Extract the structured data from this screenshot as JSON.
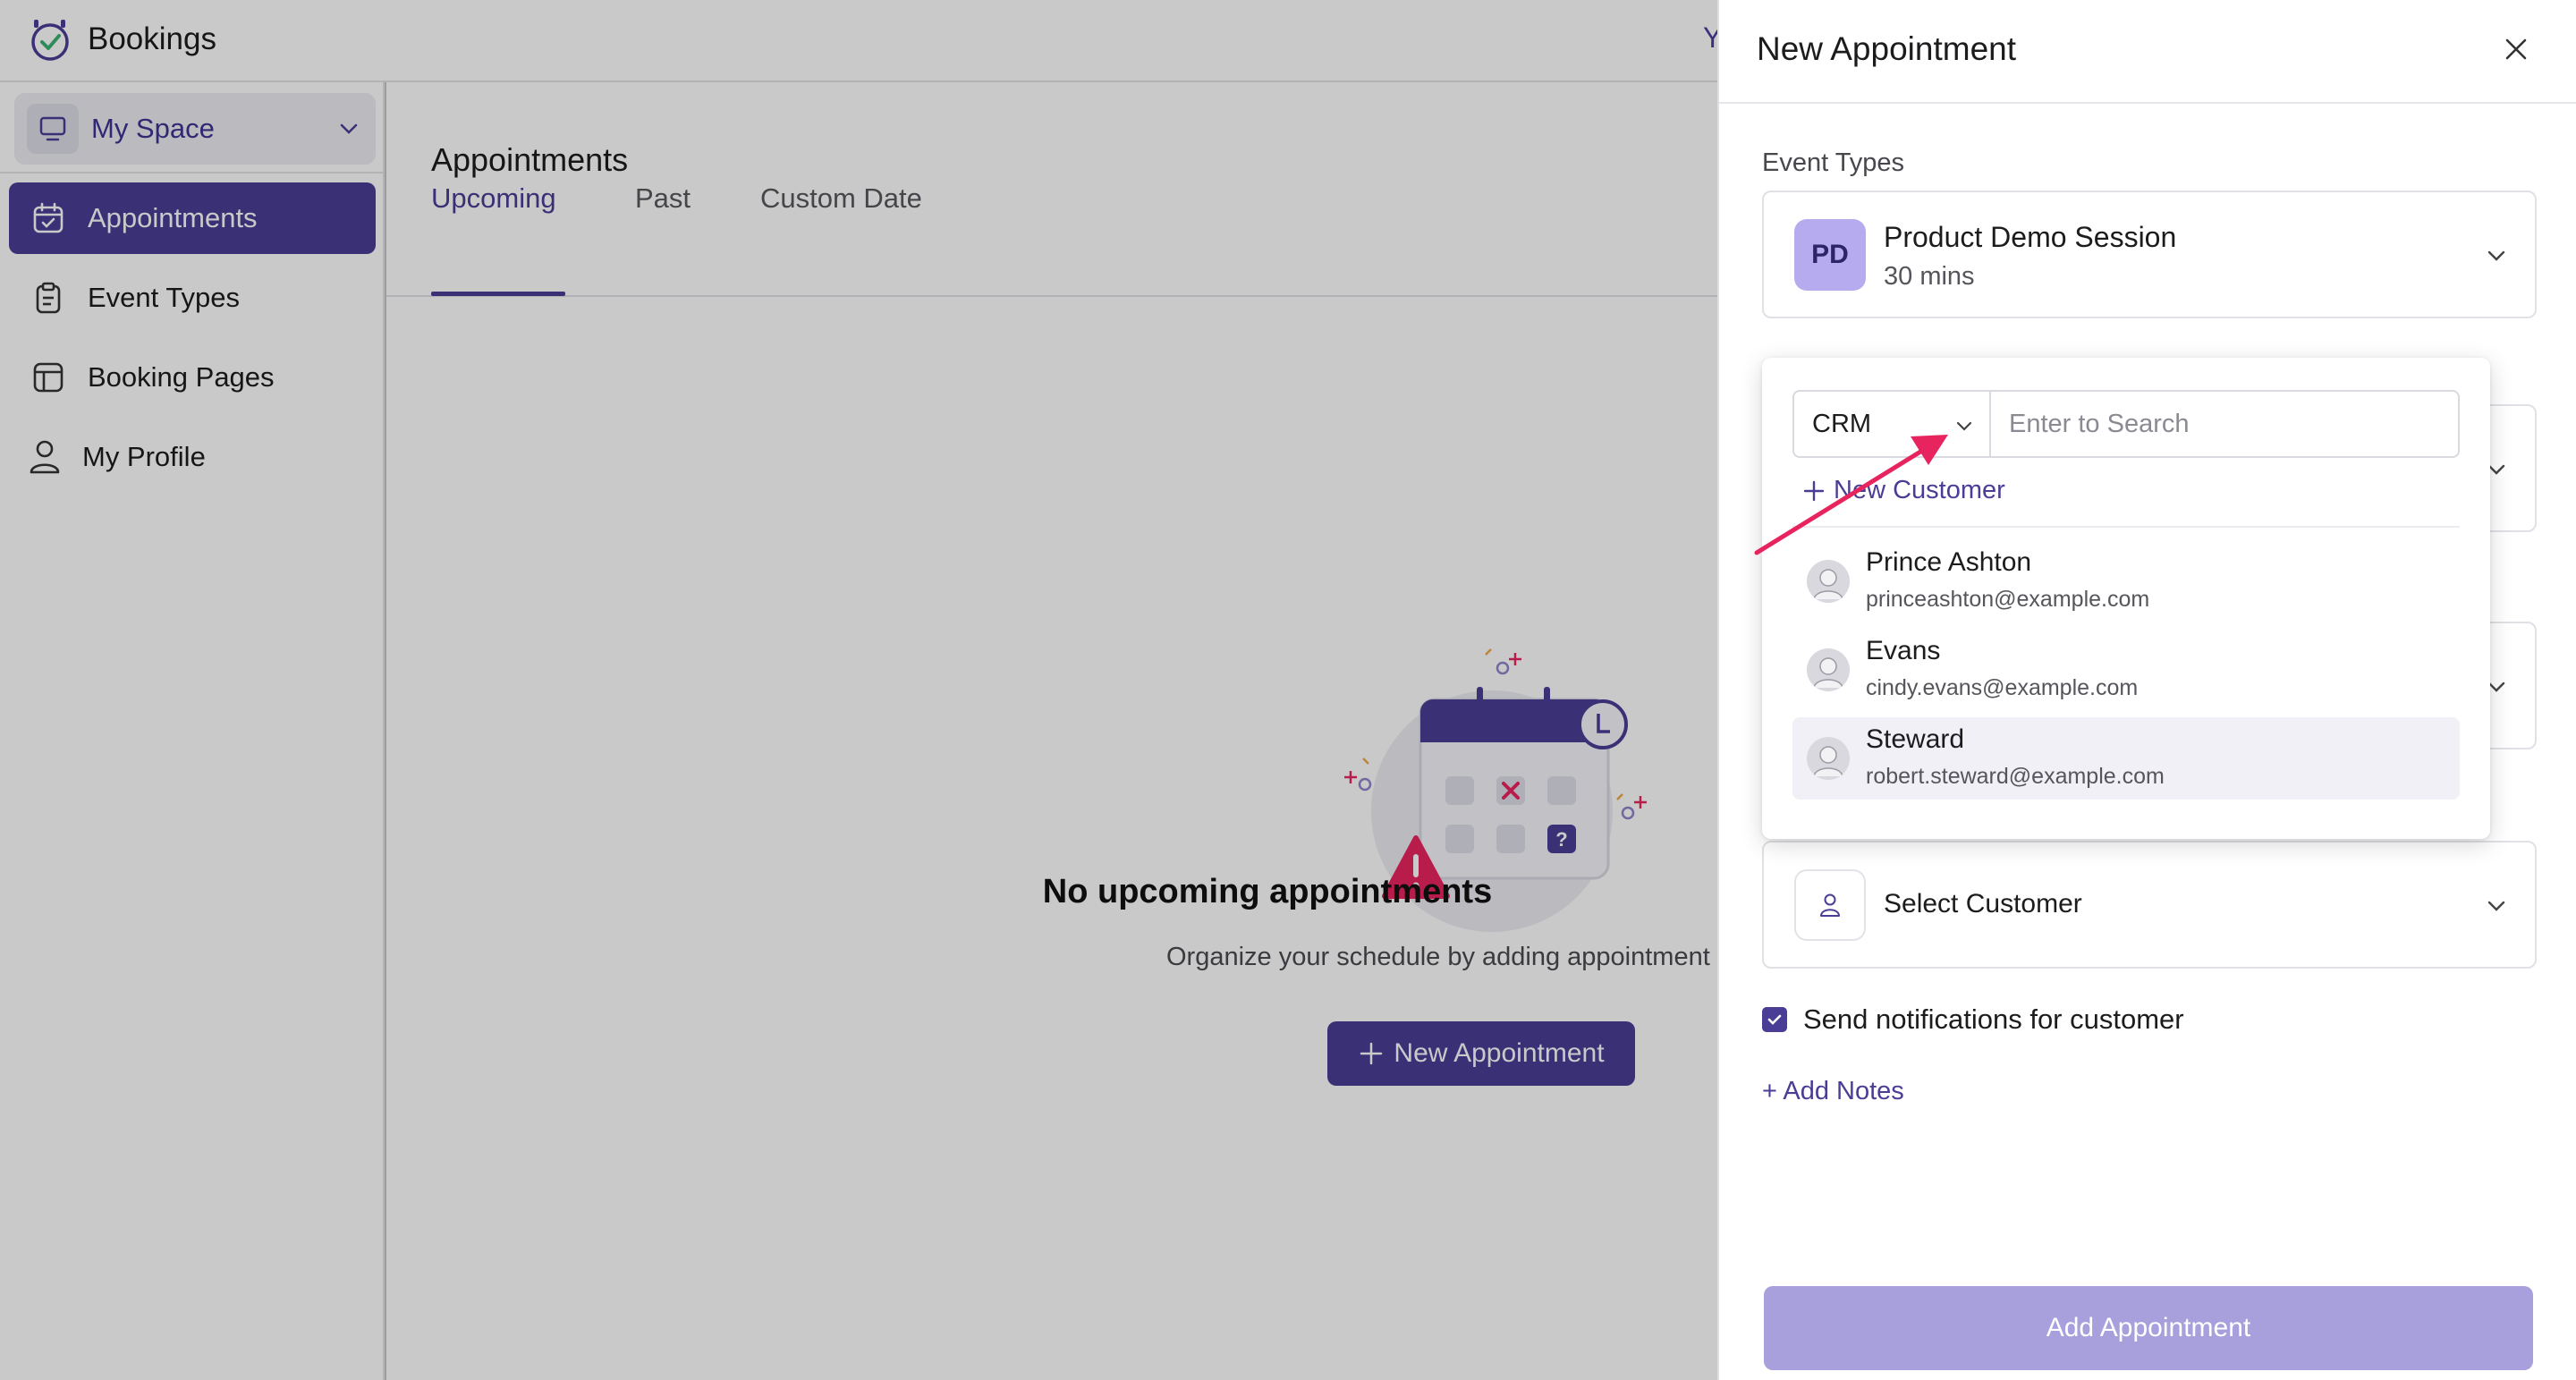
{
  "app": {
    "name": "Bookings",
    "topbar_partial_text": "Y"
  },
  "sidebar": {
    "space_label": "My Space",
    "items": [
      {
        "label": "Appointments",
        "icon": "calendar-check-icon",
        "active": true
      },
      {
        "label": "Event Types",
        "icon": "clipboard-icon",
        "active": false
      },
      {
        "label": "Booking Pages",
        "icon": "layout-icon",
        "active": false
      },
      {
        "label": "My Profile",
        "icon": "person-icon",
        "active": false
      }
    ]
  },
  "main": {
    "title": "Appointments",
    "tabs": [
      {
        "label": "Upcoming",
        "active": true
      },
      {
        "label": "Past",
        "active": false
      },
      {
        "label": "Custom Date",
        "active": false
      }
    ],
    "empty_state": {
      "title": "No upcoming appointments",
      "subtitle": "Organize your schedule by adding appointment",
      "button_label": "New Appointment"
    }
  },
  "drawer": {
    "title": "New Appointment",
    "event_types_label": "Event Types",
    "event": {
      "badge": "PD",
      "name": "Product Demo Session",
      "duration": "30 mins"
    },
    "customer_select_label": "Select Customer",
    "notify_label": "Send notifications for customer",
    "notify_checked": true,
    "add_notes_label": "+ Add Notes",
    "submit_label": "Add Appointment"
  },
  "customer_popover": {
    "source": "CRM",
    "search_placeholder": "Enter to Search",
    "new_customer_label": "New Customer",
    "customers": [
      {
        "name": "Prince Ashton",
        "email": "princeashton@example.com"
      },
      {
        "name": "Evans",
        "email": "cindy.evans@example.com"
      },
      {
        "name": "Steward",
        "email": "robert.steward@example.com"
      }
    ],
    "highlighted_index": 2
  },
  "colors": {
    "accent": "#4a3d96",
    "accent_light": "#a8a0dd",
    "badge": "#b5abee",
    "annotation_arrow": "#e8245e"
  }
}
